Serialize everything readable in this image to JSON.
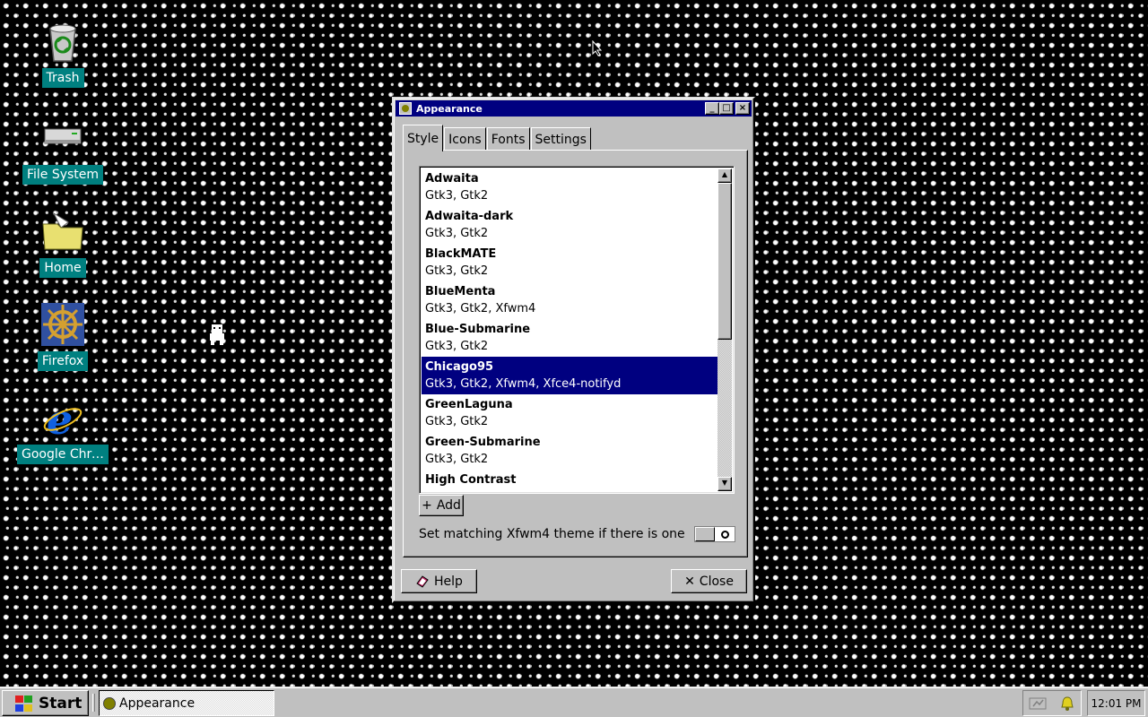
{
  "desktop": {
    "icons": [
      {
        "label": "Trash",
        "icon": "trash-icon"
      },
      {
        "label": "File System",
        "icon": "drive-icon"
      },
      {
        "label": "Home",
        "icon": "folder-icon"
      },
      {
        "label": "Firefox",
        "icon": "ship-wheel-icon"
      },
      {
        "label": "Google Chro...",
        "icon": "internet-explorer-icon"
      }
    ]
  },
  "window": {
    "title": "Appearance",
    "tabs": [
      "Style",
      "Icons",
      "Fonts",
      "Settings"
    ],
    "active_tab": "Style",
    "themes": [
      {
        "name": "Adwaita",
        "engines": "Gtk3, Gtk2"
      },
      {
        "name": "Adwaita-dark",
        "engines": "Gtk3, Gtk2"
      },
      {
        "name": "BlackMATE",
        "engines": "Gtk3, Gtk2"
      },
      {
        "name": "BlueMenta",
        "engines": "Gtk3, Gtk2, Xfwm4"
      },
      {
        "name": "Blue-Submarine",
        "engines": "Gtk3, Gtk2"
      },
      {
        "name": "Chicago95",
        "engines": "Gtk3, Gtk2, Xfwm4, Xfce4-notifyd"
      },
      {
        "name": "GreenLaguna",
        "engines": "Gtk3, Gtk2"
      },
      {
        "name": "Green-Submarine",
        "engines": "Gtk3, Gtk2"
      },
      {
        "name": "High Contrast",
        "engines": ""
      }
    ],
    "selected_theme": "Chicago95",
    "add_label": "Add",
    "xfwm_label": "Set matching Xfwm4 theme if there is one",
    "xfwm_enabled": false,
    "help_label": "Help",
    "close_label": "Close"
  },
  "taskbar": {
    "start_label": "Start",
    "task_label": "Appearance",
    "clock": "12:01 PM"
  },
  "colors": {
    "titlebar": "#000080",
    "selection": "#000080",
    "desktop_label_bg": "#008080",
    "face": "#c0c0c0"
  }
}
